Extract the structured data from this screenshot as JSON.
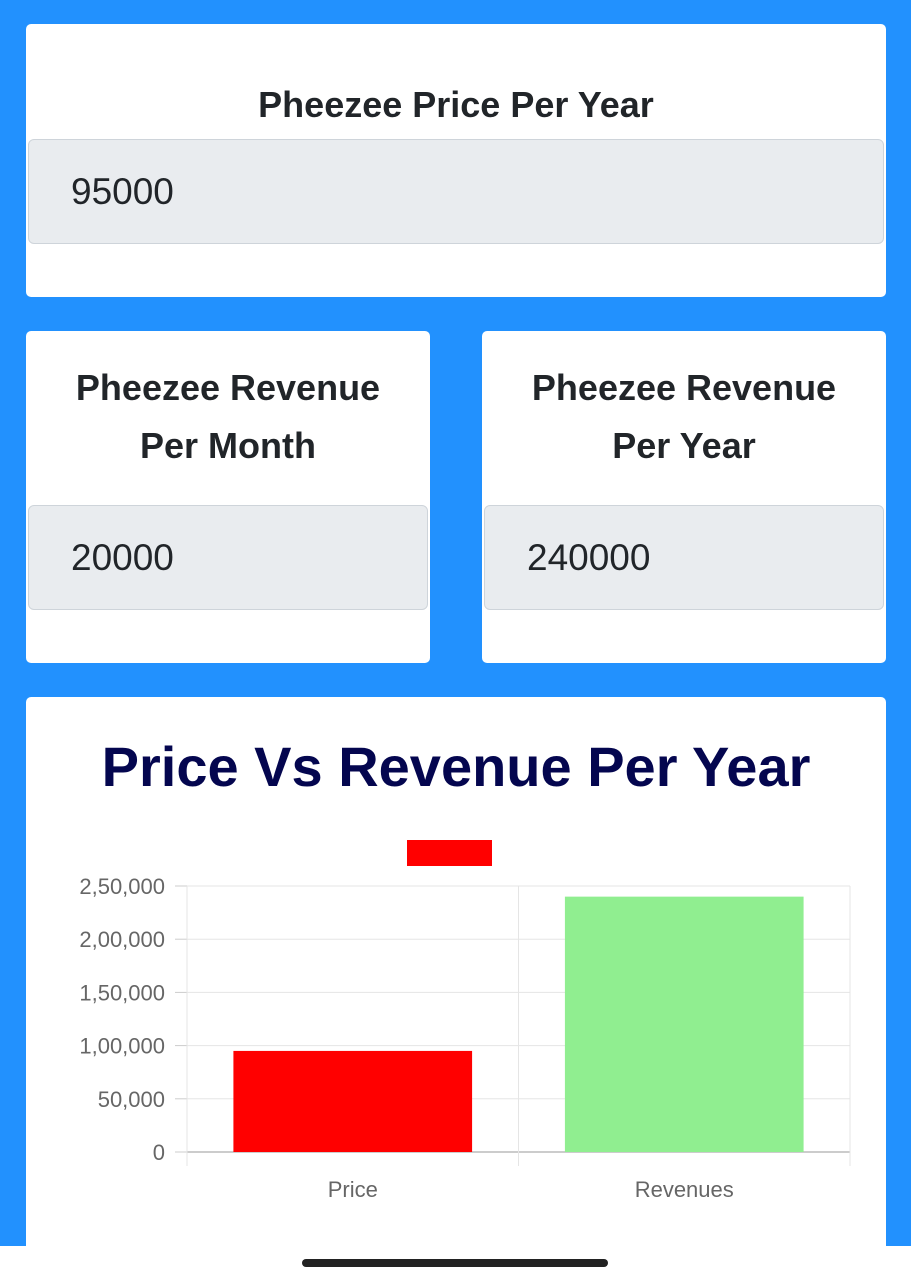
{
  "price_card": {
    "title": "Pheezee Price Per Year",
    "value": "95000"
  },
  "revenue_month_card": {
    "title_line1": "Pheezee Revenue",
    "title_line2": "Per Month",
    "value": "20000"
  },
  "revenue_year_card": {
    "title_line1": "Pheezee Revenue",
    "title_line2": "Per Year",
    "value": "240000"
  },
  "colors": {
    "page_background": "#2291fe",
    "chart_title": "#04064f",
    "price_bar": "#ff0000",
    "revenue_bar": "#90ee90"
  },
  "chart_data": {
    "type": "bar",
    "title": "Price Vs Revenue Per Year",
    "legend": {
      "placement": "top-center",
      "label": "",
      "color": "#ff0000"
    },
    "categories": [
      "Price",
      "Revenues"
    ],
    "values": [
      95000,
      240000
    ],
    "bar_colors": [
      "#ff0000",
      "#90ee90"
    ],
    "ylim": [
      0,
      250000
    ],
    "yticks": [
      0,
      50000,
      100000,
      150000,
      200000,
      250000
    ],
    "ytick_labels": [
      "0",
      "50,000",
      "1,00,000",
      "1,50,000",
      "2,00,000",
      "2,50,000"
    ],
    "xlabel": "",
    "ylabel": "",
    "grid": true
  }
}
